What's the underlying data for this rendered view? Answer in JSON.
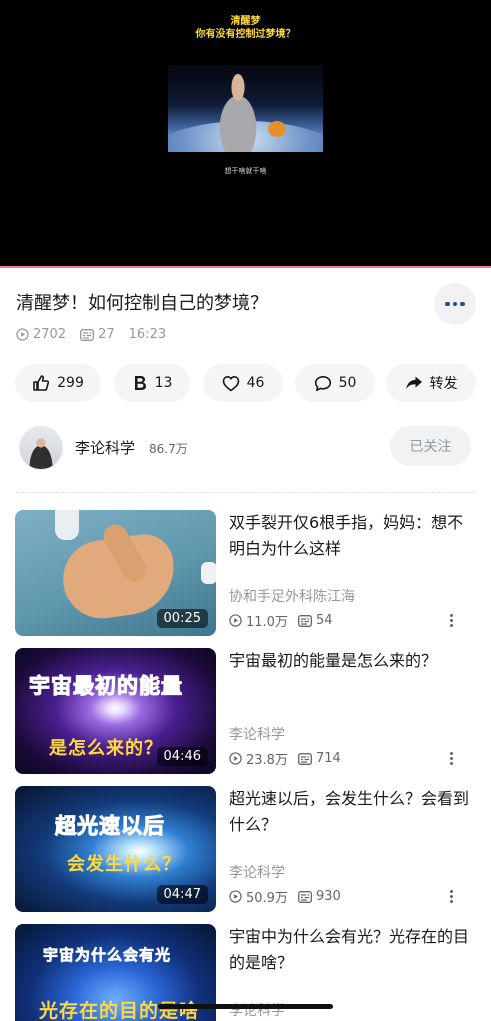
{
  "player": {
    "caption_line1": "清醒梦",
    "caption_line2": "你有没有控制过梦境？",
    "frame_subtitle": "想干啥就干啥",
    "progress": 1.0
  },
  "video": {
    "title": "清醒梦！如何控制自己的梦境？",
    "more_icon": "more-dots-icon",
    "views": "2702",
    "danmaku": "27",
    "duration": "16:23"
  },
  "actions": [
    {
      "id": "like",
      "icon": "thumb-up-icon",
      "label": "299"
    },
    {
      "id": "coin",
      "icon": "coin-b-icon",
      "label": "13"
    },
    {
      "id": "favorite",
      "icon": "heart-icon",
      "label": "46"
    },
    {
      "id": "comment",
      "icon": "comment-icon",
      "label": "50"
    },
    {
      "id": "share",
      "icon": "share-icon",
      "label": "转发"
    }
  ],
  "uploader": {
    "name": "李论科学",
    "followers": "86.7万",
    "follow_label": "已关注"
  },
  "recommendations": [
    {
      "title": "双手裂开仅6根手指，妈妈：想不明白为什么这样",
      "author": "协和手足外科陈江海",
      "views": "11.0万",
      "danmaku": "54",
      "duration": "00:25",
      "thumb_text_1": "",
      "thumb_text_2": ""
    },
    {
      "title": "宇宙最初的能量是怎么来的？",
      "author": "李论科学",
      "views": "23.8万",
      "danmaku": "714",
      "duration": "04:46",
      "thumb_text_1": "宇宙最初的能量",
      "thumb_text_2": "是怎么来的？"
    },
    {
      "title": "超光速以后，会发生什么？会看到什么？",
      "author": "李论科学",
      "views": "50.9万",
      "danmaku": "930",
      "duration": "04:47",
      "thumb_text_1": "超光速以后",
      "thumb_text_2": "会发生什么？"
    },
    {
      "title": "宇宙中为什么会有光？光存在的目的是啥？",
      "author": "李论科学",
      "views": "",
      "danmaku": "",
      "duration": "",
      "thumb_text_1": "宇宙为什么会有光",
      "thumb_text_2": "光存在的目的是啥"
    }
  ],
  "colors": {
    "accent_pink": "#fb7299",
    "caption_yellow": "#ffd83a",
    "more_dots_blue": "#2b4a9c",
    "text_gray": "#9499a0"
  }
}
